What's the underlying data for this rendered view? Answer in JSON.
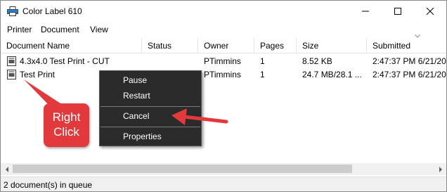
{
  "window": {
    "title": "Color Label 610",
    "icon": "printer-icon",
    "controls": [
      "minimize-icon",
      "maximize-icon",
      "close-icon"
    ]
  },
  "menu": [
    "Printer",
    "Document",
    "View"
  ],
  "columns": [
    "Document Name",
    "Status",
    "Owner",
    "Pages",
    "Size",
    "Submitted"
  ],
  "rows": [
    {
      "name": "4.3x4.0 Test Print - CUT",
      "status": "",
      "owner": "PTimmins",
      "pages": "1",
      "size": "8.52 KB",
      "submitted": "2:47:37 PM 6/21/20..."
    },
    {
      "name": "Test Print",
      "status": "",
      "owner": "PTimmins",
      "pages": "1",
      "size": "24.7 MB/28.1 ...",
      "submitted": "2:47:37 PM 6/21/20..."
    }
  ],
  "context_menu": [
    "Pause",
    "Restart",
    "Cancel",
    "Properties"
  ],
  "annotation": {
    "line1": "Right",
    "line2": "Click",
    "color": "#e2393c"
  },
  "status_bar": "2 document(s) in queue"
}
